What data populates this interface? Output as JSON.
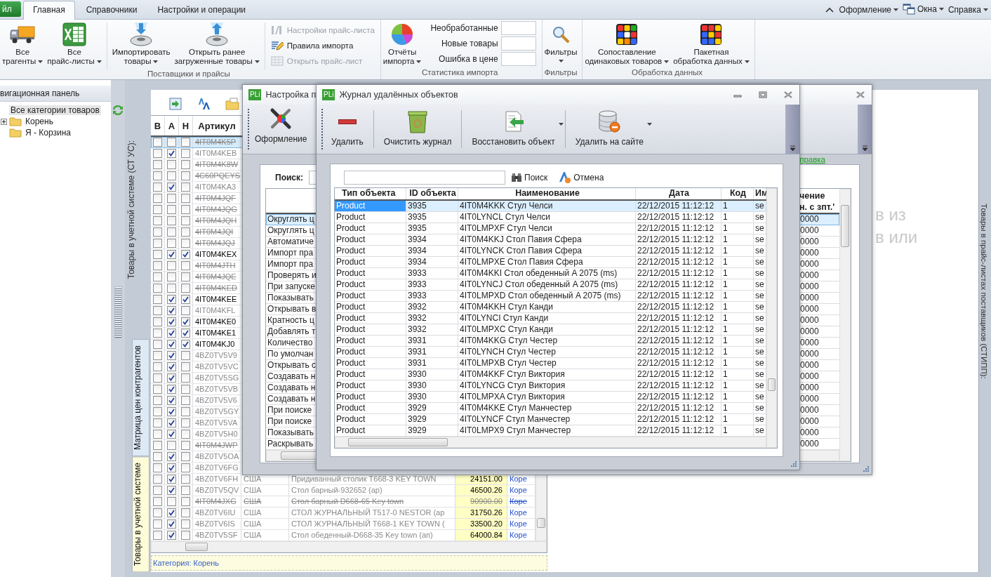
{
  "ribbon": {
    "file_tab": "йл",
    "tabs": [
      {
        "label": "Главная",
        "selected": true
      },
      {
        "label": "Справочники",
        "selected": false
      },
      {
        "label": "Настройки и операции",
        "selected": false
      }
    ],
    "right_menus": [
      {
        "label": "Оформление"
      },
      {
        "label": "Окна"
      },
      {
        "label": "Справка"
      }
    ],
    "groups": [
      {
        "label": "Поставщики и прайсы",
        "sections": [
          {
            "kind": "large",
            "buttons": [
              {
                "lines": [
                  "Все",
                  "трагенты"
                ],
                "dropdown": true
              },
              {
                "lines": [
                  "Все",
                  "прайс-листы"
                ],
                "dropdown": true
              }
            ]
          },
          {
            "kind": "separator"
          },
          {
            "kind": "large",
            "buttons": [
              {
                "lines": [
                  "Импортировать",
                  "товары"
                ],
                "dropdown": true
              },
              {
                "lines": [
                  "Открыть ранее",
                  "загруженные товары"
                ],
                "dropdown": true
              }
            ]
          },
          {
            "kind": "separator"
          },
          {
            "kind": "small",
            "buttons": [
              {
                "label": "Настройки прайс-листа",
                "disabled": true
              },
              {
                "label": "Правила импорта",
                "disabled": false
              },
              {
                "label": "Открыть прайс-лист",
                "disabled": true
              }
            ]
          }
        ]
      },
      {
        "label": "Статистика импорта",
        "sections": [
          {
            "kind": "large",
            "buttons": [
              {
                "lines": [
                  "Отчёты",
                  "импорта"
                ],
                "dropdown": true
              }
            ]
          },
          {
            "kind": "counters",
            "items": [
              {
                "label": "Необработанные"
              },
              {
                "label": "Новые товары"
              },
              {
                "label": "Ошибка в цене"
              }
            ]
          }
        ]
      },
      {
        "label": "Фильтры",
        "sections": [
          {
            "kind": "large",
            "buttons": [
              {
                "lines": [
                  "Фильтры"
                ],
                "dropdown": true
              }
            ]
          }
        ]
      },
      {
        "label": "Обработка данных",
        "sections": [
          {
            "kind": "large",
            "buttons": [
              {
                "lines": [
                  "Сопоставление",
                  "одинаковых товаров"
                ],
                "dropdown": true
              },
              {
                "lines": [
                  "Пакетная",
                  "обработка данных"
                ],
                "dropdown": true
              }
            ]
          }
        ]
      }
    ]
  },
  "navigation": {
    "title": "вигационная панель",
    "tree": [
      {
        "label": "Все категории товаров",
        "selected": true,
        "children": [
          {
            "label": "Корень",
            "selected": false,
            "expanded": false
          },
          {
            "label": "Я - Корзина",
            "selected": false
          }
        ]
      }
    ]
  },
  "main": {
    "side_label": "Товары в учетной системе (СТ УС):",
    "right_label": "Товары в прайс-листах поставщиков (СТИПП):",
    "background_text": [
      "в из",
      "в или"
    ],
    "vertical_tabs": [
      {
        "label": "Матрица цен контрагентов",
        "selected": false
      },
      {
        "label": "Товары в учетной системе",
        "selected": true
      }
    ],
    "grid": {
      "columns": [
        "В",
        "А",
        "Н",
        "Артикул"
      ],
      "rows": [
        {
          "article": "4IT0M4K5P",
          "kind": "deleted",
          "checked_v": false,
          "checked_a": false,
          "checked_n": false,
          "selected": true
        },
        {
          "article": "4IT0M4KEB",
          "kind": "inactive",
          "checked_v": false,
          "checked_a": true,
          "checked_n": false,
          "selected": false
        },
        {
          "article": "4IT0M4K8W",
          "kind": "deleted",
          "checked_v": false,
          "checked_a": false,
          "checked_n": false,
          "selected": false
        },
        {
          "article": "4C60PQEYS",
          "kind": "deleted",
          "checked_v": false,
          "checked_a": false,
          "checked_n": false,
          "selected": false
        },
        {
          "article": "4IT0M4KA3",
          "kind": "inactive",
          "checked_v": false,
          "checked_a": true,
          "checked_n": false,
          "selected": false
        },
        {
          "article": "4IT0M4JQF",
          "kind": "deleted",
          "checked_v": false,
          "checked_a": false,
          "checked_n": false,
          "selected": false
        },
        {
          "article": "4IT0M4JQG",
          "kind": "deleted",
          "checked_v": false,
          "checked_a": false,
          "checked_n": false,
          "selected": false
        },
        {
          "article": "4IT0M4JQH",
          "kind": "deleted",
          "checked_v": false,
          "checked_a": false,
          "checked_n": false,
          "selected": false
        },
        {
          "article": "4IT0M4JQI",
          "kind": "deleted",
          "checked_v": false,
          "checked_a": false,
          "checked_n": false,
          "selected": false
        },
        {
          "article": "4IT0M4JQJ",
          "kind": "deleted",
          "checked_v": false,
          "checked_a": false,
          "checked_n": false,
          "selected": false
        },
        {
          "article": "4IT0M4KEX",
          "kind": "active",
          "checked_v": false,
          "checked_a": true,
          "checked_n": true,
          "selected": false
        },
        {
          "article": "4IT0M4JTH",
          "kind": "deleted",
          "checked_v": false,
          "checked_a": false,
          "checked_n": false,
          "selected": false
        },
        {
          "article": "4IT0M4JQE",
          "kind": "deleted",
          "checked_v": false,
          "checked_a": false,
          "checked_n": false,
          "selected": false
        },
        {
          "article": "4IT0M4KED",
          "kind": "deleted",
          "checked_v": false,
          "checked_a": false,
          "checked_n": false,
          "selected": false
        },
        {
          "article": "4IT0M4KEE",
          "kind": "active",
          "checked_v": false,
          "checked_a": true,
          "checked_n": true,
          "selected": false
        },
        {
          "article": "4IT0M4KFL",
          "kind": "inactive",
          "checked_v": false,
          "checked_a": true,
          "checked_n": false,
          "selected": false
        },
        {
          "article": "4IT0M4KE0",
          "kind": "active",
          "checked_v": false,
          "checked_a": true,
          "checked_n": true,
          "selected": false
        },
        {
          "article": "4IT0M4KE1",
          "kind": "active",
          "checked_v": false,
          "checked_a": true,
          "checked_n": true,
          "selected": false
        },
        {
          "article": "4IT0M4KJ0",
          "kind": "active",
          "checked_v": false,
          "checked_a": true,
          "checked_n": true,
          "selected": false
        },
        {
          "article": "4BZ0TV5V9",
          "kind": "inactive",
          "checked_v": false,
          "checked_a": true,
          "checked_n": false,
          "selected": false
        },
        {
          "article": "4BZ0TV5VC",
          "kind": "inactive",
          "checked_v": false,
          "checked_a": true,
          "checked_n": false,
          "selected": false
        },
        {
          "article": "4BZ0TV5SG",
          "kind": "inactive",
          "checked_v": false,
          "checked_a": true,
          "checked_n": false,
          "selected": false
        },
        {
          "article": "4BZ0TV5VB",
          "kind": "inactive",
          "checked_v": false,
          "checked_a": true,
          "checked_n": false,
          "selected": false
        },
        {
          "article": "4BZ0TV5V6",
          "kind": "inactive",
          "checked_v": false,
          "checked_a": true,
          "checked_n": false,
          "selected": false
        },
        {
          "article": "4BZ0TV5GY",
          "kind": "inactive",
          "checked_v": false,
          "checked_a": true,
          "checked_n": false,
          "selected": false
        },
        {
          "article": "4BZ0TV5VA",
          "kind": "inactive",
          "checked_v": false,
          "checked_a": true,
          "checked_n": false,
          "selected": false
        },
        {
          "article": "4BZ0TV5H0",
          "kind": "inactive",
          "checked_v": false,
          "checked_a": true,
          "checked_n": false,
          "selected": false
        },
        {
          "article": "4IT0M4JWP",
          "kind": "deleted",
          "checked_v": false,
          "checked_a": false,
          "checked_n": false,
          "selected": false
        },
        {
          "article": "4BZ0TV5OA",
          "kind": "inactive",
          "checked_v": false,
          "checked_a": true,
          "checked_n": false,
          "selected": false
        },
        {
          "article": "4BZ0TV6FG",
          "kind": "inactive",
          "checked_v": false,
          "checked_a": true,
          "checked_n": false,
          "selected": false
        },
        {
          "article": "4BZ0TV6FH",
          "kind": "inactive",
          "checked_v": false,
          "checked_a": true,
          "checked_n": false,
          "selected": false,
          "country": "США",
          "name": "Придиванный столик T668-3 KEY TOWN",
          "price": "24151.00",
          "category": "Коре"
        },
        {
          "article": "4BZ0TV5QV",
          "kind": "inactive",
          "checked_v": false,
          "checked_a": true,
          "checked_n": false,
          "selected": false,
          "country": "США",
          "name": "Стол барный-932652 (ар)",
          "price": "46500.26",
          "category": "Коре"
        },
        {
          "article": "4IT0M4JXG",
          "kind": "deleted",
          "checked_v": false,
          "checked_a": false,
          "checked_n": false,
          "selected": false,
          "country": "США",
          "name": "Стол барный D668-65 Key town",
          "price": "90900.00",
          "category": "Коре"
        },
        {
          "article": "4BZ0TV6IU",
          "kind": "inactive",
          "checked_v": false,
          "checked_a": true,
          "checked_n": false,
          "selected": false,
          "country": "США",
          "name": "СТОЛ ЖУРНАЛЬНЫЙ T517-0 NESTOR (ар",
          "price": "31750.26",
          "category": "Коре"
        },
        {
          "article": "4BZ0TV6IS",
          "kind": "inactive",
          "checked_v": false,
          "checked_a": true,
          "checked_n": false,
          "selected": false,
          "country": "США",
          "name": "СТОЛ ЖУРНАЛЬНЫЙ T668-1 KEY TOWN (",
          "price": "33500.20",
          "category": "Коре"
        },
        {
          "article": "4BZ0TV5SF",
          "kind": "inactive",
          "checked_v": false,
          "checked_a": true,
          "checked_n": false,
          "selected": false,
          "country": "США",
          "name": "Стол обеденный-D668-35 Key town (ап)",
          "price": "64000.84",
          "category": "Коре"
        }
      ]
    },
    "footer": "Категория: Корень"
  },
  "settings_window": {
    "app_badge": "PLi",
    "title": "Настройка п",
    "toolbar": [
      {
        "label": "Оформление"
      }
    ],
    "help_link": "правка",
    "search_label": "Поиск:",
    "grid": {
      "value_header": "чение\nн. с зпт.'",
      "rows": [
        {
          "name": "Округлять ц",
          "value": "0000",
          "selected": true
        },
        {
          "name": "Округлять ц",
          "value": "0000",
          "selected": false
        },
        {
          "name": "Автоматиче",
          "value": "0000",
          "selected": false
        },
        {
          "name": "Импорт пра",
          "value": "0000",
          "selected": false
        },
        {
          "name": "Импорт пра",
          "value": "0000",
          "selected": false
        },
        {
          "name": "Проверять и",
          "value": "0000",
          "selected": false
        },
        {
          "name": "При запуске",
          "value": "0000",
          "selected": false
        },
        {
          "name": "Показывать",
          "value": "0000",
          "selected": false
        },
        {
          "name": "Открывать в",
          "value": "0000",
          "selected": false
        },
        {
          "name": "Кратность ц",
          "value": "0000",
          "selected": false
        },
        {
          "name": "Добавлять т",
          "value": "0000",
          "selected": false
        },
        {
          "name": "Количество",
          "value": "0000",
          "selected": false
        },
        {
          "name": "По умолчан",
          "value": "0000",
          "selected": false
        },
        {
          "name": "Открывать с",
          "value": "0000",
          "selected": false
        },
        {
          "name": "Создавать н",
          "value": "0000",
          "selected": false
        },
        {
          "name": "Создавать н",
          "value": "0000",
          "selected": false
        },
        {
          "name": "Создавать н",
          "value": "0000",
          "selected": false
        },
        {
          "name": "При поиске",
          "value": "0000",
          "selected": false
        },
        {
          "name": "При поиске",
          "value": "0000",
          "selected": false
        },
        {
          "name": "Показывать",
          "value": "0000",
          "selected": false
        },
        {
          "name": "Раскрывать",
          "value": "0000",
          "selected": false
        }
      ]
    }
  },
  "journal_window": {
    "app_badge": "PLi",
    "title": "Журнал удалённых объектов",
    "toolbar": [
      {
        "label": "Удалить",
        "dropdown": false
      },
      {
        "label": "Очистить журнал",
        "dropdown": false
      },
      {
        "label": "Восстановить объект",
        "dropdown": true
      },
      {
        "label": "Удалить на сайте",
        "dropdown": true
      }
    ],
    "search_button": "Поиск",
    "cancel_button": "Отмена",
    "table": {
      "columns": [
        "Тип объекта",
        "ID объекта",
        "Наименование",
        "Дата",
        "Код",
        "Им"
      ],
      "rows": [
        {
          "cells": [
            "Product",
            "3935",
            "4IT0M4KKK Стул Челси",
            "22/12/2015 11:12:12",
            "1",
            "se"
          ],
          "selected": true
        },
        {
          "cells": [
            "Product",
            "3935",
            "4IT0LYNCL Стул Челси",
            "22/12/2015 11:12:12",
            "1",
            "se"
          ],
          "selected": false
        },
        {
          "cells": [
            "Product",
            "3935",
            "4IT0LMPXF Стул Челси",
            "22/12/2015 11:12:12",
            "1",
            "se"
          ],
          "selected": false
        },
        {
          "cells": [
            "Product",
            "3934",
            "4IT0M4KKJ Стол Павия Сфера",
            "22/12/2015 11:12:12",
            "1",
            "se"
          ],
          "selected": false
        },
        {
          "cells": [
            "Product",
            "3934",
            "4IT0LYNCK Стол Павия Сфера",
            "22/12/2015 11:12:12",
            "1",
            "se"
          ],
          "selected": false
        },
        {
          "cells": [
            "Product",
            "3934",
            "4IT0LMPXE Стол Павия Сфера",
            "22/12/2015 11:12:12",
            "1",
            "se"
          ],
          "selected": false
        },
        {
          "cells": [
            "Product",
            "3933",
            "4IT0M4KKI Стол обеденный A 2075 (ms)",
            "22/12/2015 11:12:12",
            "1",
            "se"
          ],
          "selected": false
        },
        {
          "cells": [
            "Product",
            "3933",
            "4IT0LYNCJ Стол обеденный A 2075 (ms)",
            "22/12/2015 11:12:12",
            "1",
            "se"
          ],
          "selected": false
        },
        {
          "cells": [
            "Product",
            "3933",
            "4IT0LMPXD Стол обеденный A 2075 (ms)",
            "22/12/2015 11:12:12",
            "1",
            "se"
          ],
          "selected": false
        },
        {
          "cells": [
            "Product",
            "3932",
            "4IT0M4KKH Стул Канди",
            "22/12/2015 11:12:12",
            "1",
            "se"
          ],
          "selected": false
        },
        {
          "cells": [
            "Product",
            "3932",
            "4IT0LYNCI Стул Канди",
            "22/12/2015 11:12:12",
            "1",
            "se"
          ],
          "selected": false
        },
        {
          "cells": [
            "Product",
            "3932",
            "4IT0LMPXC Стул Канди",
            "22/12/2015 11:12:12",
            "1",
            "se"
          ],
          "selected": false
        },
        {
          "cells": [
            "Product",
            "3931",
            "4IT0M4KKG Стул Честер",
            "22/12/2015 11:12:12",
            "1",
            "se"
          ],
          "selected": false
        },
        {
          "cells": [
            "Product",
            "3931",
            "4IT0LYNCH Стул Честер",
            "22/12/2015 11:12:12",
            "1",
            "se"
          ],
          "selected": false
        },
        {
          "cells": [
            "Product",
            "3931",
            "4IT0LMPXB Стул Честер",
            "22/12/2015 11:12:12",
            "1",
            "se"
          ],
          "selected": false
        },
        {
          "cells": [
            "Product",
            "3930",
            "4IT0M4KKF Стул Виктория",
            "22/12/2015 11:12:12",
            "1",
            "se"
          ],
          "selected": false
        },
        {
          "cells": [
            "Product",
            "3930",
            "4IT0LYNCG Стул Виктория",
            "22/12/2015 11:12:12",
            "1",
            "se"
          ],
          "selected": false
        },
        {
          "cells": [
            "Product",
            "3930",
            "4IT0LMPXA Стул Виктория",
            "22/12/2015 11:12:12",
            "1",
            "se"
          ],
          "selected": false
        },
        {
          "cells": [
            "Product",
            "3929",
            "4IT0M4KKE Стул Манчестер",
            "22/12/2015 11:12:12",
            "1",
            "se"
          ],
          "selected": false
        },
        {
          "cells": [
            "Product",
            "3929",
            "4IT0LYNCF Стул Манчестер",
            "22/12/2015 11:12:12",
            "1",
            "se"
          ],
          "selected": false
        },
        {
          "cells": [
            "Product",
            "3929",
            "4IT0LMPX9 Стул Манчестер",
            "22/12/2015 11:12:12",
            "1",
            "se"
          ],
          "selected": false
        }
      ]
    }
  }
}
